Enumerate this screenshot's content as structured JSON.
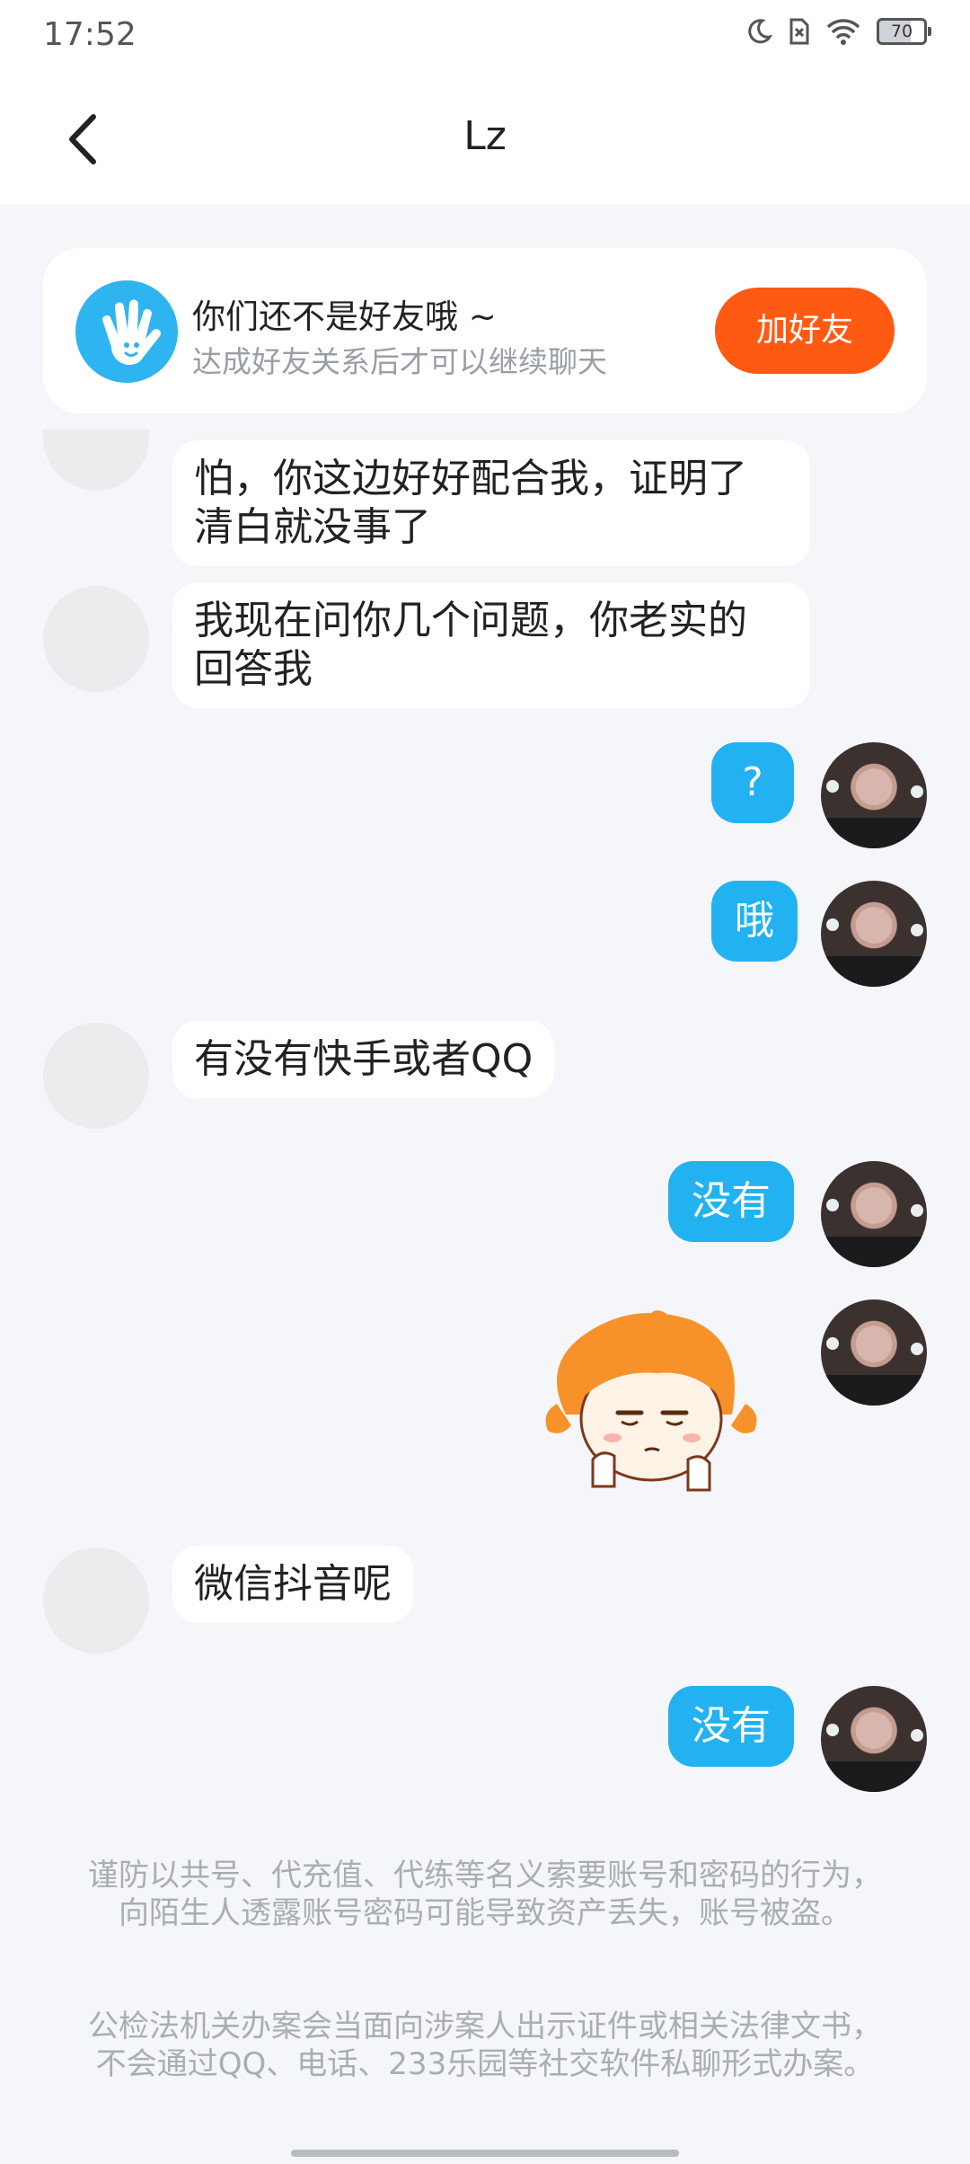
{
  "status_bar": {
    "time": "17:52",
    "battery": "70"
  },
  "header": {
    "title": "Lz"
  },
  "friend_banner": {
    "title": "你们还不是好友哦 ~",
    "subtitle": "达成好友关系后才可以继续聊天",
    "add_button": "加好友"
  },
  "messages": [
    {
      "side": "in",
      "lines": [
        "怕，你这边好好配合我，证明了",
        "清白就没事了"
      ]
    },
    {
      "side": "in",
      "lines": [
        "我现在问你几个问题，你老实的",
        "回答我"
      ]
    },
    {
      "side": "out",
      "text": "?"
    },
    {
      "side": "out",
      "text": "哦"
    },
    {
      "side": "in",
      "text": "有没有快手或者QQ"
    },
    {
      "side": "out",
      "text": "没有"
    },
    {
      "side": "out",
      "type": "sticker",
      "sticker": "orange-hair-girl-sticker"
    },
    {
      "side": "in",
      "text": "微信抖音呢"
    },
    {
      "side": "out",
      "text": "没有"
    }
  ],
  "disclaimers": [
    "谨防以共号、代充值、代练等名义索要账号和密码的行为，向陌生人透露账号密码可能导致资产丢失，账号被盗。",
    "公检法机关办案会当面向涉案人出示证件或相关法律文书，不会通过QQ、电话、233乐园等社交软件私聊形式办案。"
  ],
  "colors": {
    "accent": "#22b2f2",
    "add_button": "#ff5a14",
    "background": "#f4f6f9"
  }
}
